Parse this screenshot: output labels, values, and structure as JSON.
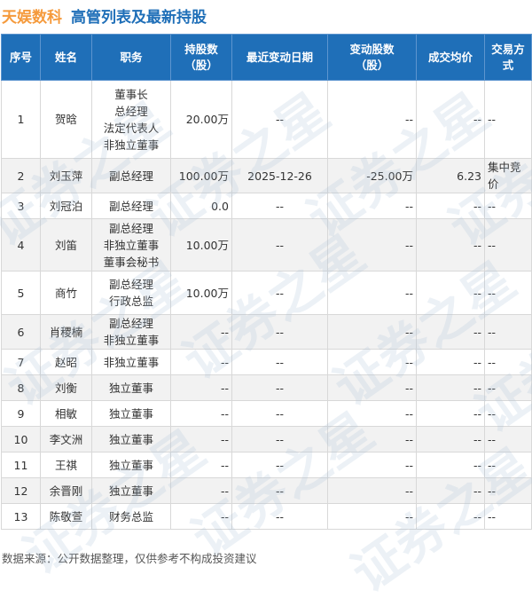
{
  "header": {
    "company": "天娱数科",
    "title": "高管列表及最新持股"
  },
  "table": {
    "columns": [
      "序号",
      "姓名",
      "职务",
      "持股数\n（股）",
      "最近变动日期",
      "变动股数\n（股）",
      "成交均价",
      "交易方式"
    ],
    "rows": [
      {
        "no": "1",
        "name": "贺晗",
        "positions": [
          "董事长",
          "总经理",
          "法定代表人",
          "非独立董事"
        ],
        "shares": "20.00万",
        "date": "--",
        "change": "--",
        "price": "--",
        "method": "--"
      },
      {
        "no": "2",
        "name": "刘玉萍",
        "positions": [
          "副总经理"
        ],
        "shares": "100.00万",
        "date": "2025-12-26",
        "change": "-25.00万",
        "price": "6.23",
        "method": "集中竞价"
      },
      {
        "no": "3",
        "name": "刘冠泊",
        "positions": [
          "副总经理"
        ],
        "shares": "0.0",
        "date": "--",
        "change": "--",
        "price": "--",
        "method": "--"
      },
      {
        "no": "4",
        "name": "刘笛",
        "positions": [
          "副总经理",
          "非独立董事",
          "董事会秘书"
        ],
        "shares": "10.00万",
        "date": "--",
        "change": "--",
        "price": "--",
        "method": "--"
      },
      {
        "no": "5",
        "name": "商竹",
        "positions": [
          "副总经理",
          "行政总监"
        ],
        "shares": "10.00万",
        "date": "--",
        "change": "--",
        "price": "--",
        "method": "--"
      },
      {
        "no": "6",
        "name": "肖稷楠",
        "positions": [
          "副总经理",
          "非独立董事"
        ],
        "shares": "--",
        "date": "--",
        "change": "--",
        "price": "--",
        "method": "--"
      },
      {
        "no": "7",
        "name": "赵昭",
        "positions": [
          "非独立董事"
        ],
        "shares": "--",
        "date": "--",
        "change": "--",
        "price": "--",
        "method": "--"
      },
      {
        "no": "8",
        "name": "刘衡",
        "positions": [
          "独立董事"
        ],
        "shares": "--",
        "date": "--",
        "change": "--",
        "price": "--",
        "method": "--"
      },
      {
        "no": "9",
        "name": "相敏",
        "positions": [
          "独立董事"
        ],
        "shares": "--",
        "date": "--",
        "change": "--",
        "price": "--",
        "method": "--"
      },
      {
        "no": "10",
        "name": "李文洲",
        "positions": [
          "独立董事"
        ],
        "shares": "--",
        "date": "--",
        "change": "--",
        "price": "--",
        "method": "--"
      },
      {
        "no": "11",
        "name": "王祺",
        "positions": [
          "独立董事"
        ],
        "shares": "--",
        "date": "--",
        "change": "--",
        "price": "--",
        "method": "--"
      },
      {
        "no": "12",
        "name": "余晋刚",
        "positions": [
          "独立董事"
        ],
        "shares": "--",
        "date": "--",
        "change": "--",
        "price": "--",
        "method": "--"
      },
      {
        "no": "13",
        "name": "陈敬萱",
        "positions": [
          "财务总监"
        ],
        "shares": "--",
        "date": "--",
        "change": "--",
        "price": "--",
        "method": "--"
      }
    ]
  },
  "footer": {
    "source": "数据来源：公开数据整理，仅供参考不构成投资建议"
  },
  "watermark": {
    "text": "证券之星"
  },
  "colors": {
    "company": "#f59a3c",
    "title": "#1f6fb8",
    "header_bg": "#1f6fb8",
    "negative": "#2a9d2a"
  }
}
